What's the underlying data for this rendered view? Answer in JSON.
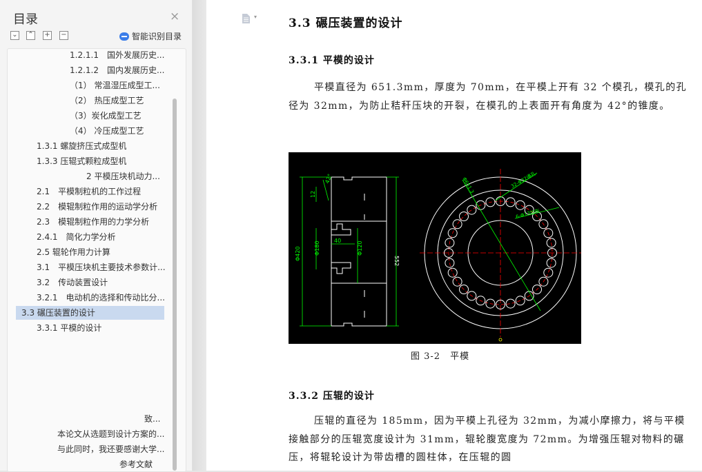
{
  "toc": {
    "title": "目录",
    "close_icon": "×",
    "buttons": {
      "collapse": "⌄",
      "expand": "⌃",
      "plus": "+",
      "minus": "−"
    },
    "smart_label": "智能识别目录",
    "items": [
      "1.2.1.1　国外发展历史...",
      "1.2.1.2　国内发展历史...",
      "（1）  常温湿压成型工...",
      "（2）  热压成型工艺",
      "（3）炭化成型工艺",
      "（4）  冷压成型工艺",
      "1.3.1  螺旋挤压式成型机",
      "1.3.3  压辊式颗粒成型机",
      "2 平模压块机动力...",
      "2.1　平模制粒机的工作过程",
      "2.2　模辊制粒作用的运动学分析",
      "2.3　模辊制粒作用的力学分析",
      "2.4.1　简化力学分析",
      "2.5  辊轮作用力计算",
      "3.1　平模压块机主要技术参数计...",
      "3.2　传动装置设计",
      "3.2.1　电动机的选择和传动比分...",
      "3.3 碾压装置的设计",
      "3.3.1 平模的设计",
      "致...",
      "本论文从选题到设计方案的...",
      "与此同时，我还要感谢大学...",
      "参考文献"
    ],
    "selected_index": 17
  },
  "doc": {
    "heading_3_3": "3.3 碾压装置的设计",
    "heading_3_3_1": "3.3.1 平模的设计",
    "para1": "平模直径为 651.3mm，厚度为 70mm，在平模上开有 32 个模孔，模孔的孔径为 32mm，为防止秸秆压块的开裂，在模孔的上表面开有角度为 42°的锥度。",
    "figure_caption": "图 3-2　平模",
    "heading_3_3_2": "3.3.2 压辊的设计",
    "para2": "压辊的直径为 185mm，因为平模上孔径为 32mm，为减小摩擦力，将与平模接触部分的压辊宽度设计为 31mm，辊轮腹宽度为 72mm。为增强压辊对物料的碾压，将辊轮设计为带齿槽的圆柱体，在压辊的圆"
  },
  "figure": {
    "dim_labels": {
      "phi420": "Φ420",
      "phi180": "Φ180",
      "phi120": "Φ120",
      "d552": "552",
      "d42": "42°",
      "d12": "12",
      "d40": "40",
      "phi651": "Φ651.3",
      "hole_label": "32-Φ32通孔",
      "eq_label": "6-Φ17均布"
    },
    "colors": {
      "bg": "#000000",
      "outline": "#ffffff",
      "dim": "#00ff00",
      "center": "#ff0000"
    }
  }
}
